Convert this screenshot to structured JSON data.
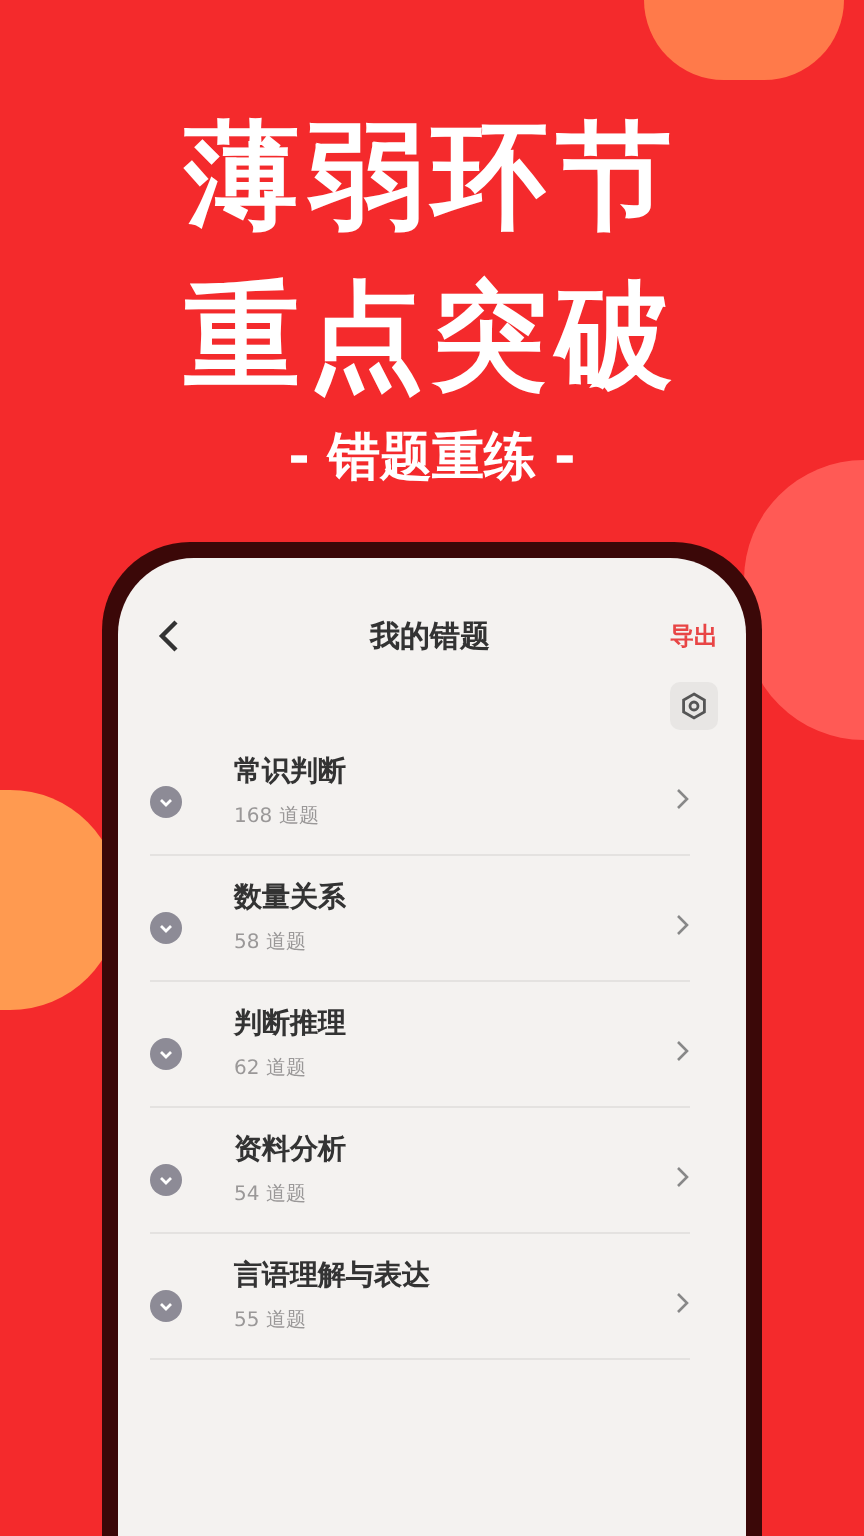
{
  "headline": [
    "薄弱环节",
    "重点突破"
  ],
  "subtitle": "- 错题重练 -",
  "screen": {
    "title": "我的错题",
    "action": "导出",
    "categories": [
      {
        "name": "常识判断",
        "count": "168 道题"
      },
      {
        "name": "数量关系",
        "count": "58 道题"
      },
      {
        "name": "判断推理",
        "count": "62 道题"
      },
      {
        "name": "资料分析",
        "count": "54 道题"
      },
      {
        "name": "言语理解与表达",
        "count": "55 道题"
      }
    ]
  }
}
